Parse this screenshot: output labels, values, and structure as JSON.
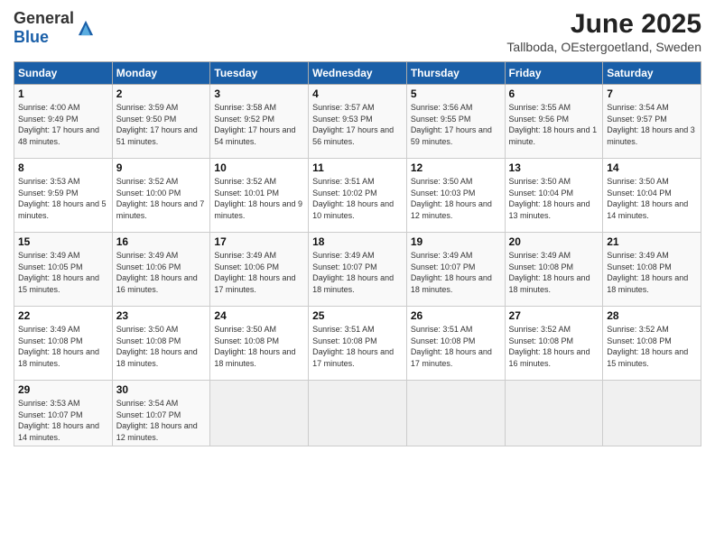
{
  "logo": {
    "general": "General",
    "blue": "Blue"
  },
  "title": {
    "month_year": "June 2025",
    "location": "Tallboda, OEstergoetland, Sweden"
  },
  "headers": [
    "Sunday",
    "Monday",
    "Tuesday",
    "Wednesday",
    "Thursday",
    "Friday",
    "Saturday"
  ],
  "weeks": [
    [
      {
        "day": "1",
        "sunrise": "4:00 AM",
        "sunset": "9:49 PM",
        "daylight": "17 hours and 48 minutes."
      },
      {
        "day": "2",
        "sunrise": "3:59 AM",
        "sunset": "9:50 PM",
        "daylight": "17 hours and 51 minutes."
      },
      {
        "day": "3",
        "sunrise": "3:58 AM",
        "sunset": "9:52 PM",
        "daylight": "17 hours and 54 minutes."
      },
      {
        "day": "4",
        "sunrise": "3:57 AM",
        "sunset": "9:53 PM",
        "daylight": "17 hours and 56 minutes."
      },
      {
        "day": "5",
        "sunrise": "3:56 AM",
        "sunset": "9:55 PM",
        "daylight": "17 hours and 59 minutes."
      },
      {
        "day": "6",
        "sunrise": "3:55 AM",
        "sunset": "9:56 PM",
        "daylight": "18 hours and 1 minute."
      },
      {
        "day": "7",
        "sunrise": "3:54 AM",
        "sunset": "9:57 PM",
        "daylight": "18 hours and 3 minutes."
      }
    ],
    [
      {
        "day": "8",
        "sunrise": "3:53 AM",
        "sunset": "9:59 PM",
        "daylight": "18 hours and 5 minutes."
      },
      {
        "day": "9",
        "sunrise": "3:52 AM",
        "sunset": "10:00 PM",
        "daylight": "18 hours and 7 minutes."
      },
      {
        "day": "10",
        "sunrise": "3:52 AM",
        "sunset": "10:01 PM",
        "daylight": "18 hours and 9 minutes."
      },
      {
        "day": "11",
        "sunrise": "3:51 AM",
        "sunset": "10:02 PM",
        "daylight": "18 hours and 10 minutes."
      },
      {
        "day": "12",
        "sunrise": "3:50 AM",
        "sunset": "10:03 PM",
        "daylight": "18 hours and 12 minutes."
      },
      {
        "day": "13",
        "sunrise": "3:50 AM",
        "sunset": "10:04 PM",
        "daylight": "18 hours and 13 minutes."
      },
      {
        "day": "14",
        "sunrise": "3:50 AM",
        "sunset": "10:04 PM",
        "daylight": "18 hours and 14 minutes."
      }
    ],
    [
      {
        "day": "15",
        "sunrise": "3:49 AM",
        "sunset": "10:05 PM",
        "daylight": "18 hours and 15 minutes."
      },
      {
        "day": "16",
        "sunrise": "3:49 AM",
        "sunset": "10:06 PM",
        "daylight": "18 hours and 16 minutes."
      },
      {
        "day": "17",
        "sunrise": "3:49 AM",
        "sunset": "10:06 PM",
        "daylight": "18 hours and 17 minutes."
      },
      {
        "day": "18",
        "sunrise": "3:49 AM",
        "sunset": "10:07 PM",
        "daylight": "18 hours and 18 minutes."
      },
      {
        "day": "19",
        "sunrise": "3:49 AM",
        "sunset": "10:07 PM",
        "daylight": "18 hours and 18 minutes."
      },
      {
        "day": "20",
        "sunrise": "3:49 AM",
        "sunset": "10:08 PM",
        "daylight": "18 hours and 18 minutes."
      },
      {
        "day": "21",
        "sunrise": "3:49 AM",
        "sunset": "10:08 PM",
        "daylight": "18 hours and 18 minutes."
      }
    ],
    [
      {
        "day": "22",
        "sunrise": "3:49 AM",
        "sunset": "10:08 PM",
        "daylight": "18 hours and 18 minutes."
      },
      {
        "day": "23",
        "sunrise": "3:50 AM",
        "sunset": "10:08 PM",
        "daylight": "18 hours and 18 minutes."
      },
      {
        "day": "24",
        "sunrise": "3:50 AM",
        "sunset": "10:08 PM",
        "daylight": "18 hours and 18 minutes."
      },
      {
        "day": "25",
        "sunrise": "3:51 AM",
        "sunset": "10:08 PM",
        "daylight": "18 hours and 17 minutes."
      },
      {
        "day": "26",
        "sunrise": "3:51 AM",
        "sunset": "10:08 PM",
        "daylight": "18 hours and 17 minutes."
      },
      {
        "day": "27",
        "sunrise": "3:52 AM",
        "sunset": "10:08 PM",
        "daylight": "18 hours and 16 minutes."
      },
      {
        "day": "28",
        "sunrise": "3:52 AM",
        "sunset": "10:08 PM",
        "daylight": "18 hours and 15 minutes."
      }
    ],
    [
      {
        "day": "29",
        "sunrise": "3:53 AM",
        "sunset": "10:07 PM",
        "daylight": "18 hours and 14 minutes."
      },
      {
        "day": "30",
        "sunrise": "3:54 AM",
        "sunset": "10:07 PM",
        "daylight": "18 hours and 12 minutes."
      },
      null,
      null,
      null,
      null,
      null
    ]
  ]
}
